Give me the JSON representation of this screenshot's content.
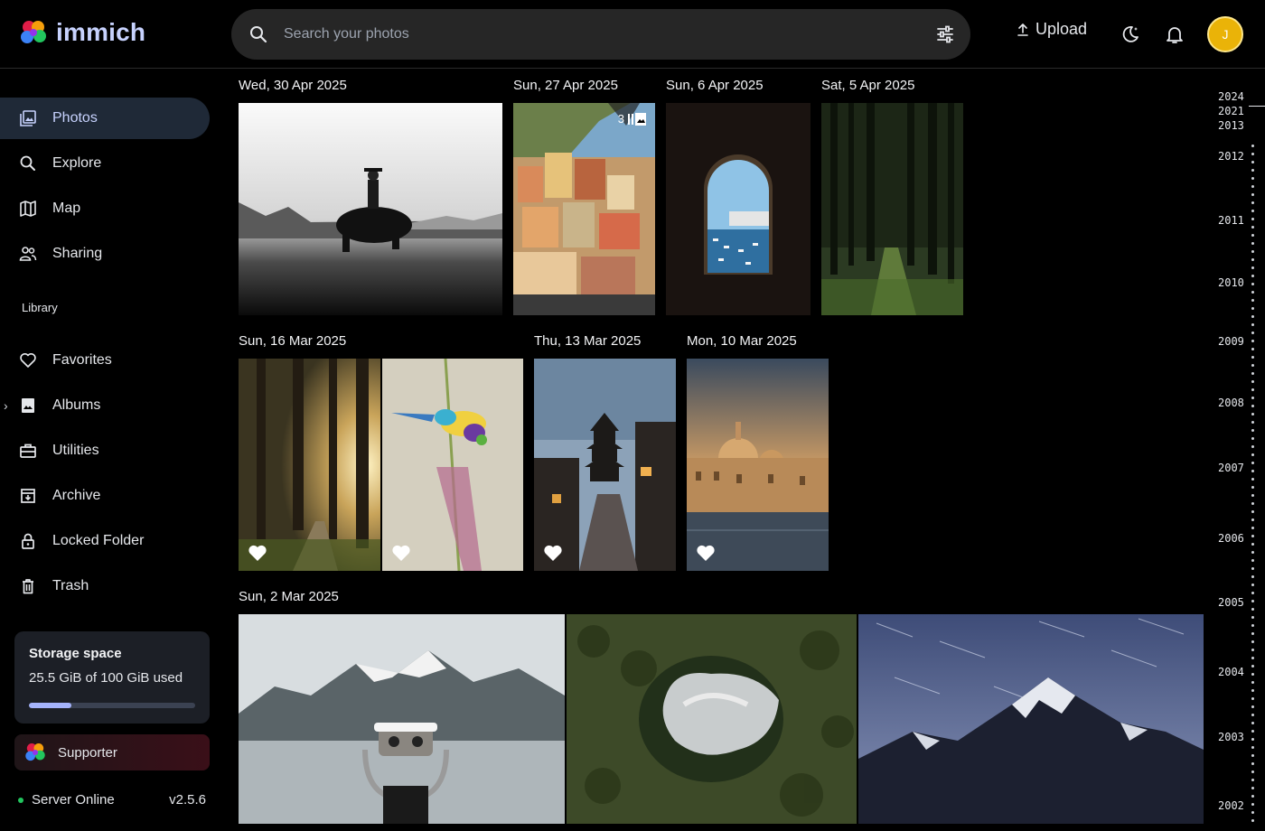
{
  "header": {
    "app_name": "immich",
    "search_placeholder": "Search your photos",
    "upload_label": "Upload",
    "avatar_initial": "J"
  },
  "sidebar": {
    "items": [
      {
        "label": "Photos",
        "icon": "photos-icon"
      },
      {
        "label": "Explore",
        "icon": "search-icon"
      },
      {
        "label": "Map",
        "icon": "map-icon"
      },
      {
        "label": "Sharing",
        "icon": "people-icon"
      }
    ],
    "library_label": "Library",
    "library_items": [
      {
        "label": "Favorites",
        "icon": "heart-icon"
      },
      {
        "label": "Albums",
        "icon": "album-icon"
      },
      {
        "label": "Utilities",
        "icon": "toolbox-icon"
      },
      {
        "label": "Archive",
        "icon": "archive-icon"
      },
      {
        "label": "Locked Folder",
        "icon": "lock-icon"
      },
      {
        "label": "Trash",
        "icon": "trash-icon"
      }
    ],
    "storage": {
      "title": "Storage space",
      "usage": "25.5 GiB of 100 GiB used",
      "used_fraction": 0.255
    },
    "supporter_label": "Supporter",
    "server_status": "Server Online",
    "version": "v2.5.6"
  },
  "timeline": {
    "groups": [
      {
        "date": "Wed, 30 Apr 2025"
      },
      {
        "date": "Sun, 27 Apr 2025",
        "stack_count": "3"
      },
      {
        "date": "Sun, 6 Apr 2025"
      },
      {
        "date": "Sat, 5 Apr 2025"
      },
      {
        "date": "Sun, 16 Mar 2025"
      },
      {
        "date": "Thu, 13 Mar 2025"
      },
      {
        "date": "Mon, 10 Mar 2025"
      },
      {
        "date": "Sun, 2 Mar 2025"
      }
    ]
  },
  "scrubber": {
    "years": [
      "2024",
      "2021",
      "2013",
      "2012",
      "2011",
      "2010",
      "2009",
      "2008",
      "2007",
      "2006",
      "2005",
      "2004",
      "2003",
      "2002"
    ]
  },
  "colors": {
    "accent": "#c7d2fe",
    "active_bg": "#1f2937",
    "online": "#22c55e",
    "avatar": "#eab308"
  }
}
